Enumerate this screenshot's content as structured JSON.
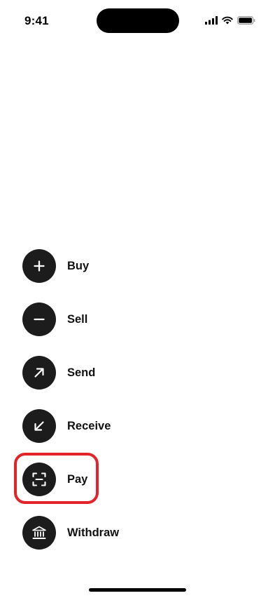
{
  "status_bar": {
    "time": "9:41",
    "signal_icon": "cellular-signal-icon",
    "wifi_icon": "wifi-icon",
    "battery_icon": "battery-icon"
  },
  "actions": [
    {
      "label": "Buy",
      "icon": "plus-icon"
    },
    {
      "label": "Sell",
      "icon": "minus-icon"
    },
    {
      "label": "Send",
      "icon": "arrow-up-right-icon"
    },
    {
      "label": "Receive",
      "icon": "arrow-down-left-icon"
    },
    {
      "label": "Pay",
      "icon": "scan-icon"
    },
    {
      "label": "Withdraw",
      "icon": "bank-icon"
    }
  ],
  "highlight": {
    "target": "Pay",
    "color": "#e2242a"
  }
}
